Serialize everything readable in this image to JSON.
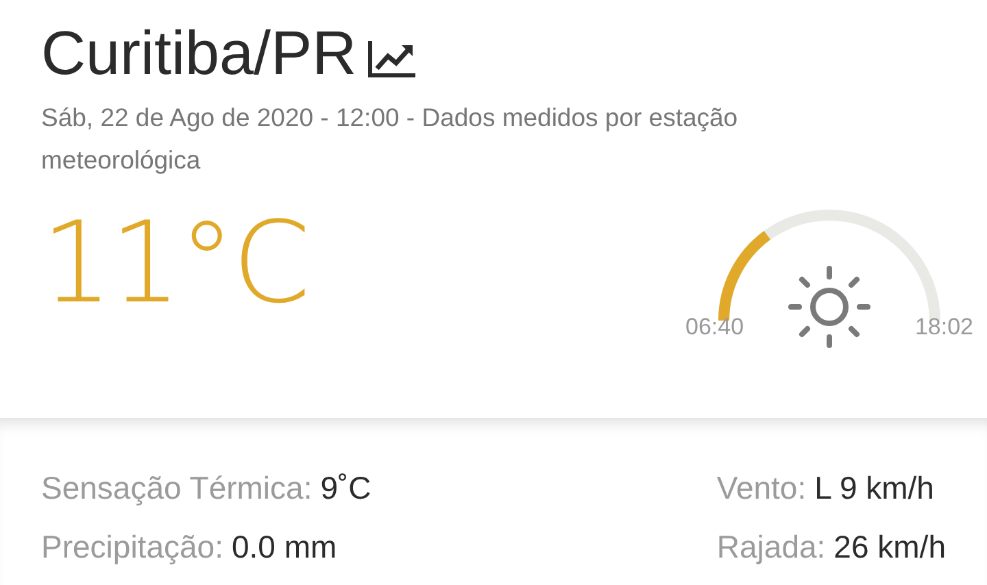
{
  "city": "Curitiba/PR",
  "subtitle": "Sáb, 22 de Ago de 2020 - 12:00 - Dados medidos por estação meteorológica",
  "temperature": "11°C",
  "sun": {
    "sunrise": "06:40",
    "sunset": "18:02"
  },
  "details_left": [
    {
      "label": "Sensação Térmica:",
      "value": "9˚C"
    },
    {
      "label": "Precipitação:",
      "value": "0.0 mm"
    }
  ],
  "details_right": [
    {
      "label": "Vento:",
      "value": "L 9 km/h"
    },
    {
      "label": "Rajada:",
      "value": "26 km/h"
    }
  ]
}
